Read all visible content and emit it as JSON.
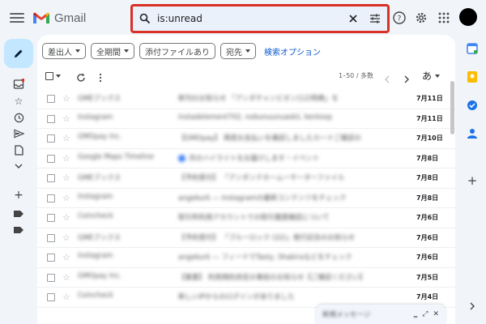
{
  "app": {
    "name": "Gmail"
  },
  "search": {
    "query": "is:unread"
  },
  "filters": {
    "chips": [
      "差出人",
      "全期間",
      "添付ファイルあり",
      "宛先"
    ],
    "advanced_search": "検索オプション"
  },
  "toolbar": {
    "page_info": "1–50 / 多数",
    "input_tool": "あ"
  },
  "emails": [
    {
      "sender": "GMEブックス",
      "snippet": "新刊のお知らせ 「アンダチャンピオン(12)特典」を",
      "date": "7月11日"
    },
    {
      "sender": "Instagram",
      "snippet": "instadelement702, nobunuunuaskii, kentoop",
      "date": "7月11日"
    },
    {
      "sender": "GMOpay Inc.",
      "snippet": "【GMOpay】 再度お支払いを確認しましたカードご確認の",
      "date": "7月10日"
    },
    {
      "sender": "Google Maps Timeline",
      "snippet": "月のハイライトをお届けします・イベント",
      "date": "7月8日"
    },
    {
      "sender": "GMEブックス",
      "snippet": "【予約受付】 「アンダンテホームーサーターファイル",
      "date": "7月8日"
    },
    {
      "sender": "Instagram",
      "snippet": "angekurk — Instagramの最新コンテンツをチェック",
      "date": "7月8日"
    },
    {
      "sender": "Coincheck",
      "snippet": "取引所利用アカウントでの取引履歴確認について",
      "date": "7月6日"
    },
    {
      "sender": "GMEブックス",
      "snippet": "【予約受付】 「ブルーロック (22)」発行記念のお知らせ",
      "date": "7月6日"
    },
    {
      "sender": "Instagram",
      "snippet": "angekurk — フィードでTasty, Shakiraなどをチェック",
      "date": "7月6日"
    },
    {
      "sender": "GMOpay Inc.",
      "snippet": "【重要】 利用規約改定の事前のお知らせ【ご確認ください】",
      "date": "7月5日"
    },
    {
      "sender": "Coincheck",
      "snippet": "新しいIPからのログインがありました",
      "date": "7月4日"
    }
  ],
  "popup": {
    "title": "新規メッセージ"
  },
  "colors": {
    "search_highlight": "#d93025",
    "compose_bg": "#c2e7ff",
    "accent_blue": "#0b57d0"
  }
}
